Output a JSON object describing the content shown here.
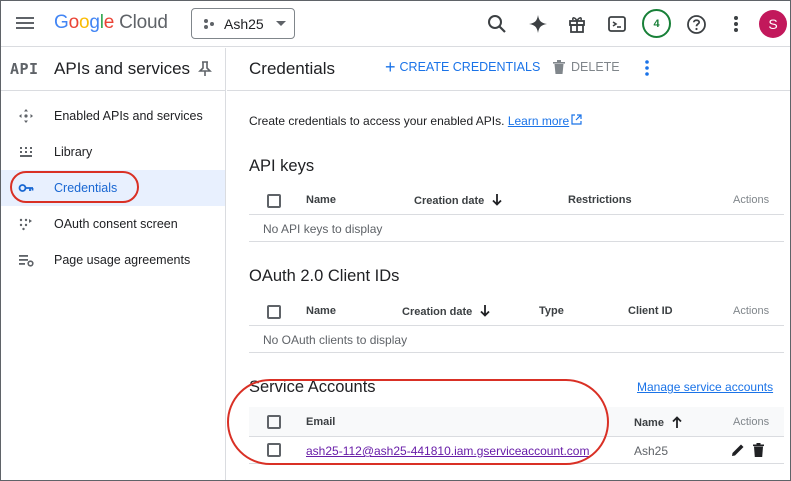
{
  "topbar": {
    "logo_letters": [
      "G",
      "o",
      "o",
      "g",
      "l",
      "e"
    ],
    "logo_suffix": "Cloud",
    "project_name": "Ash25",
    "notification_count": "4",
    "avatar_letter": "S"
  },
  "sidebar": {
    "api_badge": "API",
    "title": "APIs and services",
    "items": [
      {
        "label": "Enabled APIs and services",
        "icon": "diamond-arrows-icon"
      },
      {
        "label": "Library",
        "icon": "library-icon"
      },
      {
        "label": "Credentials",
        "icon": "key-icon"
      },
      {
        "label": "OAuth consent screen",
        "icon": "oauth-icon"
      },
      {
        "label": "Page usage agreements",
        "icon": "settings-list-icon"
      }
    ],
    "active_index": 2
  },
  "main": {
    "title": "Credentials",
    "create_label": "CREATE CREDENTIALS",
    "delete_label": "DELETE",
    "description": "Create credentials to access your enabled APIs.",
    "learn_more": "Learn more",
    "api_keys": {
      "heading": "API keys",
      "columns": [
        "Name",
        "Creation date",
        "Restrictions",
        "Actions"
      ],
      "empty": "No API keys to display"
    },
    "oauth": {
      "heading": "OAuth 2.0 Client IDs",
      "columns": [
        "Name",
        "Creation date",
        "Type",
        "Client ID",
        "Actions"
      ],
      "empty": "No OAuth clients to display"
    },
    "service_accounts": {
      "heading": "Service Accounts",
      "manage_link": "Manage service accounts",
      "columns": [
        "Email",
        "Name",
        "Actions"
      ],
      "rows": [
        {
          "email": "ash25-112@ash25-441810.iam.gserviceaccount.com",
          "name": "Ash25"
        }
      ]
    }
  },
  "colors": {
    "accent": "#1a73e8",
    "highlight_circle": "#d93025",
    "active_bg": "#e8f0fe",
    "avatar": "#c2185b",
    "badge": "#188038"
  }
}
